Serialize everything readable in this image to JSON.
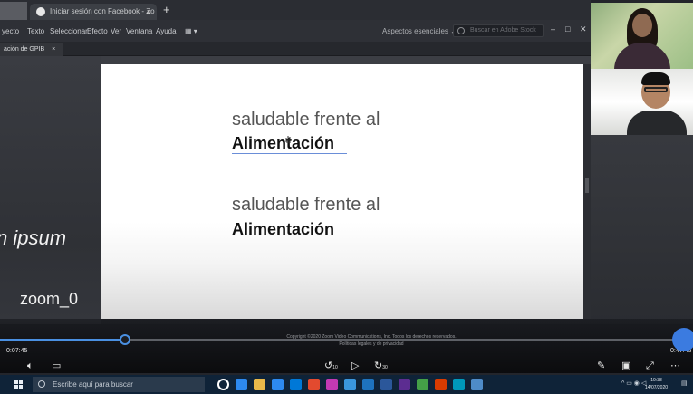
{
  "browser": {
    "tab_title": "Iniciar sesión con Facebook - Zo",
    "tab_close": "×",
    "new_tab": "+"
  },
  "menubar": {
    "items": [
      "yecto",
      "Texto",
      "Seleccionar",
      "Efecto",
      "Ver",
      "Ventana",
      "Ayuda"
    ],
    "workspace_label": "Aspectos esenciales",
    "search_placeholder": "Buscar en Adobe Stock",
    "window_controls": [
      "–",
      "□",
      "✕"
    ]
  },
  "project_tab": {
    "label": "ación de GPIB",
    "close": "×"
  },
  "left_panel": {
    "text_ipsum": "n ipsum",
    "text_zoom": "zoom_0"
  },
  "artboard": {
    "lines": [
      {
        "text": "saludable frente al"
      },
      {
        "text": "Alimentación"
      },
      {
        "text": "saludable frente al"
      },
      {
        "text": "Alimentación"
      }
    ]
  },
  "copyright": {
    "line1": "Copyright ©2020 Zoom Video Communications, Inc. Todos los derechos reservados.",
    "line2": "Políticas legales y de privacidad"
  },
  "player": {
    "current_time": "0:07:45",
    "total_time": "0:47:46",
    "progress_fraction": 0.18,
    "accent_color": "#4a90e2",
    "rewind_label": "10",
    "forward_label": "30",
    "left_icons": [
      "volume-icon",
      "captions-icon"
    ],
    "center_icons": [
      "rewind-10-icon",
      "play-icon",
      "forward-30-icon"
    ],
    "right_icons": [
      "pen-icon",
      "miniplayer-icon",
      "expand-icon",
      "more-icon"
    ]
  },
  "taskbar": {
    "search_placeholder": "Escribe aquí para buscar",
    "time": "10:38",
    "date": "14/07/2020",
    "app_colors": [
      "#ffffff",
      "#2d89ef",
      "#e8b84a",
      "#2d89ef",
      "#0078d7",
      "#e34a2f",
      "#c239b3",
      "#3a96dd",
      "#1e73be",
      "#2b579a",
      "#5c2d91",
      "#44a047",
      "#d83b01",
      "#0099bc",
      "#4e8bc8"
    ]
  }
}
